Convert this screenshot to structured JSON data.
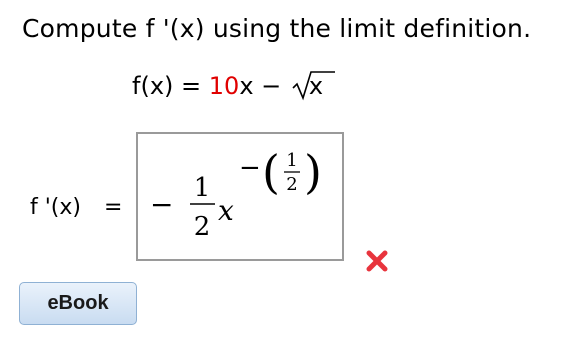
{
  "prompt": {
    "before": "Compute ",
    "function_name": "f '(x)",
    "after": " using the limit definition."
  },
  "given": {
    "lhs": "f(x)",
    "equals": "=",
    "coef": "10",
    "var": "x",
    "minus": "−",
    "radicand": "x"
  },
  "answer": {
    "label": "f '(x)",
    "equals": "=",
    "expression": {
      "sign": "−",
      "numerator": "1",
      "denominator": "2",
      "base": "x",
      "exponent": {
        "sign": "−",
        "open_paren": "(",
        "numerator": "1",
        "denominator": "2",
        "close_paren": ")"
      }
    }
  },
  "feedback": {
    "status": "incorrect",
    "icon": "x-mark-icon",
    "color": "#e8343d"
  },
  "ebook_button": {
    "label": "eBook"
  }
}
